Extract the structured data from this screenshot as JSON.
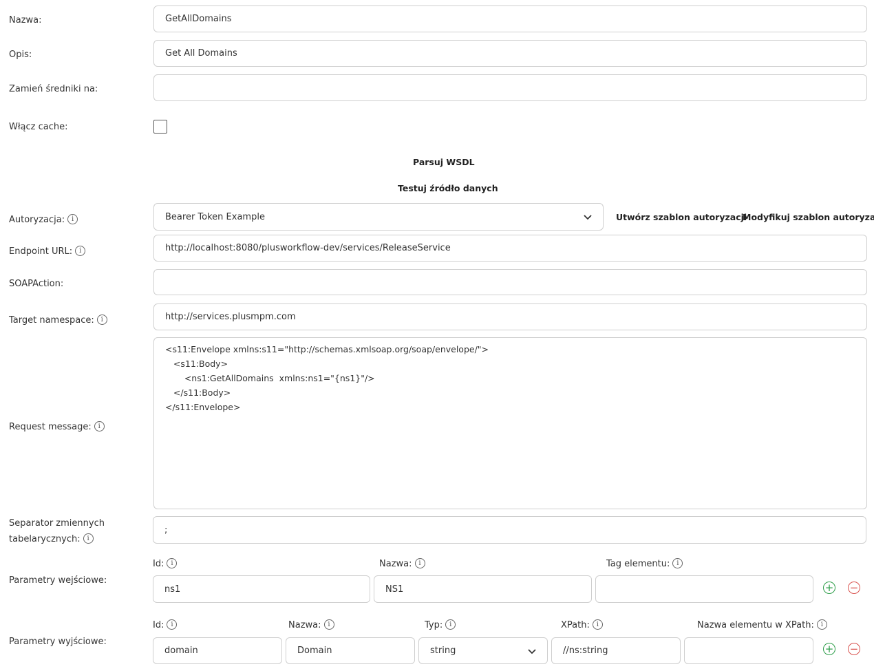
{
  "form": {
    "nazwa_label": "Nazwa:",
    "nazwa_value": "GetAllDomains",
    "opis_label": "Opis:",
    "opis_value": "Get All Domains",
    "zamien_label": "Zamień średniki na:",
    "zamien_value": "",
    "cache_label": "Włącz cache:",
    "cache_checked": false,
    "parse_wsdl": "Parsuj WSDL",
    "test_source": "Testuj źródło danych",
    "auth_label": "Autoryzacja:",
    "auth_value": "Bearer Token Example",
    "create_auth": "Utwórz szablon autoryzacji",
    "modify_auth": "Modyfikuj szablon autoryzacji",
    "endpoint_label": "Endpoint URL:",
    "endpoint_value": "http://localhost:8080/plusworkflow-dev/services/ReleaseService",
    "soapaction_label": "SOAPAction:",
    "soapaction_value": "",
    "target_ns_label": "Target namespace:",
    "target_ns_value": "http://services.plusmpm.com",
    "request_label": "Request message:",
    "request_value": "<s11:Envelope xmlns:s11=\"http://schemas.xmlsoap.org/soap/envelope/\">\n   <s11:Body>\n       <ns1:GetAllDomains  xmlns:ns1=\"{ns1}\"/>\n   </s11:Body>\n</s11:Envelope>",
    "separator_label_1": "Separator zmiennych",
    "separator_label_2": "tabelarycznych:",
    "separator_value": ";",
    "input_params_label": "Parametry wejściowe:",
    "output_params_label": "Parametry wyjściowe:"
  },
  "input_params": {
    "id_label": "Id:",
    "nazwa_label": "Nazwa:",
    "tag_label": "Tag elementu:",
    "id_value": "ns1",
    "nazwa_value": "NS1",
    "tag_value": ""
  },
  "output_params": {
    "id_label": "Id:",
    "nazwa_label": "Nazwa:",
    "typ_label": "Typ:",
    "xpath_label": "XPath:",
    "xpath_name_label": "Nazwa elementu w XPath:",
    "id_value": "domain",
    "nazwa_value": "Domain",
    "typ_value": "string",
    "xpath_value": "//ns:string",
    "xpath_name_value": ""
  },
  "icons": {
    "info": "info-icon",
    "add": "plus-circle-icon",
    "remove": "minus-circle-icon",
    "dropdown": "chevron-down-icon"
  },
  "colors": {
    "add": "#2e9e4a",
    "remove": "#d9534f"
  }
}
